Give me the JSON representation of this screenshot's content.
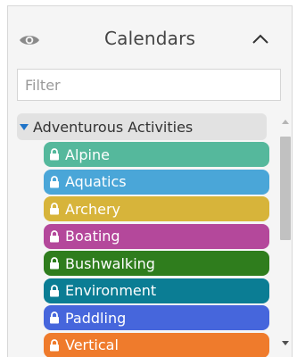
{
  "header": {
    "title": "Calendars",
    "visibility_icon": "eye-icon",
    "collapse_icon": "chevron-up-icon"
  },
  "filter": {
    "placeholder": "Filter",
    "value": ""
  },
  "group": {
    "label": "Adventurous Activities",
    "expanded": true,
    "caret_icon": "caret-down-icon"
  },
  "calendars": [
    {
      "label": "Alpine",
      "color": "#55b89c",
      "icon": "lock-icon"
    },
    {
      "label": "Aquatics",
      "color": "#4aa6d8",
      "icon": "lock-icon"
    },
    {
      "label": "Archery",
      "color": "#d7b43a",
      "icon": "lock-icon"
    },
    {
      "label": "Boating",
      "color": "#b4489b",
      "icon": "lock-icon"
    },
    {
      "label": "Bushwalking",
      "color": "#2f7d1d",
      "icon": "lock-icon"
    },
    {
      "label": "Environment",
      "color": "#0b7d94",
      "icon": "lock-icon"
    },
    {
      "label": "Paddling",
      "color": "#4666dc",
      "icon": "lock-icon"
    },
    {
      "label": "Vertical",
      "color": "#ef7b2c",
      "icon": "lock-icon"
    }
  ],
  "colors": {
    "panel_bg": "#f5f5f5",
    "group_bg": "#e2e2e2",
    "caret": "#1e73c8",
    "icon_gray": "#8a8a8a"
  }
}
